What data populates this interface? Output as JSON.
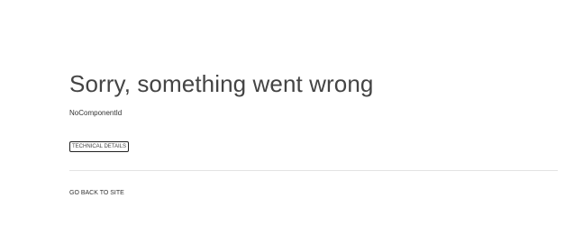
{
  "error": {
    "title": "Sorry, something went wrong",
    "code": "NoComponentId",
    "details_button_label": "TECHNICAL DETAILS",
    "back_link_label": "GO BACK TO SITE"
  }
}
